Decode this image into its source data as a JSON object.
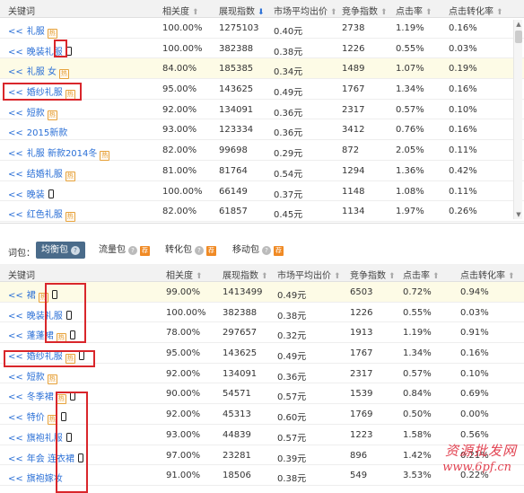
{
  "columns": {
    "keyword": "关键词",
    "relevance": "相关度",
    "impressions": "展现指数",
    "avg_bid": "市场平均出价",
    "competition": "竞争指数",
    "ctr": "点击率",
    "cvr": "点击转化率"
  },
  "arrow_up": "⬆",
  "arrow_down": "⬇",
  "prefix": "<<",
  "badge_text": "热",
  "top_table": {
    "rows": [
      {
        "keyword": "礼服",
        "badge": true,
        "phone": false,
        "relevance": "100.00%",
        "impressions": "1275103",
        "avg_bid": "0.40元",
        "competition": "2738",
        "ctr": "1.19%",
        "cvr": "0.16%"
      },
      {
        "keyword": "晚装礼服",
        "badge": false,
        "phone": true,
        "relevance": "100.00%",
        "impressions": "382388",
        "avg_bid": "0.38元",
        "competition": "1226",
        "ctr": "0.55%",
        "cvr": "0.03%"
      },
      {
        "keyword": "礼服 女",
        "badge": true,
        "phone": false,
        "relevance": "84.00%",
        "impressions": "185385",
        "avg_bid": "0.34元",
        "competition": "1489",
        "ctr": "1.07%",
        "cvr": "0.19%",
        "highlight": true
      },
      {
        "keyword": "婚纱礼服",
        "badge": true,
        "phone": false,
        "relevance": "95.00%",
        "impressions": "143625",
        "avg_bid": "0.49元",
        "competition": "1767",
        "ctr": "1.34%",
        "cvr": "0.16%"
      },
      {
        "keyword": "短款",
        "badge": true,
        "phone": false,
        "relevance": "92.00%",
        "impressions": "134091",
        "avg_bid": "0.36元",
        "competition": "2317",
        "ctr": "0.57%",
        "cvr": "0.10%"
      },
      {
        "keyword": "2015新款",
        "badge": false,
        "phone": false,
        "relevance": "93.00%",
        "impressions": "123334",
        "avg_bid": "0.36元",
        "competition": "3412",
        "ctr": "0.76%",
        "cvr": "0.16%"
      },
      {
        "keyword": "礼服 新款2014冬",
        "badge": true,
        "phone": false,
        "relevance": "82.00%",
        "impressions": "99698",
        "avg_bid": "0.29元",
        "competition": "872",
        "ctr": "2.05%",
        "cvr": "0.11%"
      },
      {
        "keyword": "结婚礼服",
        "badge": true,
        "phone": false,
        "relevance": "81.00%",
        "impressions": "81764",
        "avg_bid": "0.54元",
        "competition": "1294",
        "ctr": "1.36%",
        "cvr": "0.42%"
      },
      {
        "keyword": "晚装",
        "badge": false,
        "phone": true,
        "relevance": "100.00%",
        "impressions": "66149",
        "avg_bid": "0.37元",
        "competition": "1148",
        "ctr": "1.08%",
        "cvr": "0.11%"
      },
      {
        "keyword": "红色礼服",
        "badge": true,
        "phone": false,
        "relevance": "82.00%",
        "impressions": "61857",
        "avg_bid": "0.45元",
        "competition": "1134",
        "ctr": "1.97%",
        "cvr": "0.26%"
      }
    ]
  },
  "package_bar": {
    "label": "词包：",
    "tabs": [
      {
        "label": "均衡包",
        "active": true,
        "hot": false
      },
      {
        "label": "流量包",
        "active": false,
        "hot": true
      },
      {
        "label": "转化包",
        "active": false,
        "hot": true
      },
      {
        "label": "移动包",
        "active": false,
        "hot": true
      }
    ],
    "help": "?",
    "hot_text": "荐"
  },
  "bottom_table": {
    "rows": [
      {
        "keyword": "裙",
        "badge": true,
        "phone": true,
        "relevance": "99.00%",
        "impressions": "1413499",
        "avg_bid": "0.49元",
        "competition": "6503",
        "ctr": "0.72%",
        "cvr": "0.94%",
        "highlight": true
      },
      {
        "keyword": "晚装礼服",
        "badge": false,
        "phone": true,
        "relevance": "100.00%",
        "impressions": "382388",
        "avg_bid": "0.38元",
        "competition": "1226",
        "ctr": "0.55%",
        "cvr": "0.03%"
      },
      {
        "keyword": "蓬蓬裙",
        "badge": true,
        "phone": true,
        "relevance": "78.00%",
        "impressions": "297657",
        "avg_bid": "0.32元",
        "competition": "1913",
        "ctr": "1.19%",
        "cvr": "0.91%"
      },
      {
        "keyword": "婚纱礼服",
        "badge": true,
        "phone": true,
        "relevance": "95.00%",
        "impressions": "143625",
        "avg_bid": "0.49元",
        "competition": "1767",
        "ctr": "1.34%",
        "cvr": "0.16%"
      },
      {
        "keyword": "短款",
        "badge": true,
        "phone": false,
        "relevance": "92.00%",
        "impressions": "134091",
        "avg_bid": "0.36元",
        "competition": "2317",
        "ctr": "0.57%",
        "cvr": "0.10%"
      },
      {
        "keyword": "冬季裙",
        "badge": true,
        "phone": true,
        "relevance": "90.00%",
        "impressions": "54571",
        "avg_bid": "0.57元",
        "competition": "1539",
        "ctr": "0.84%",
        "cvr": "0.69%"
      },
      {
        "keyword": "特价",
        "badge": true,
        "phone": true,
        "relevance": "92.00%",
        "impressions": "45313",
        "avg_bid": "0.60元",
        "competition": "1769",
        "ctr": "0.50%",
        "cvr": "0.00%"
      },
      {
        "keyword": "旗袍礼服",
        "badge": false,
        "phone": true,
        "relevance": "93.00%",
        "impressions": "44839",
        "avg_bid": "0.57元",
        "competition": "1223",
        "ctr": "1.58%",
        "cvr": "0.56%"
      },
      {
        "keyword": "年会 连衣裙",
        "badge": false,
        "phone": true,
        "relevance": "97.00%",
        "impressions": "23281",
        "avg_bid": "0.39元",
        "competition": "896",
        "ctr": "1.42%",
        "cvr": "0.21%"
      },
      {
        "keyword": "旗袍嫁妆",
        "badge": false,
        "phone": false,
        "relevance": "91.00%",
        "impressions": "18506",
        "avg_bid": "0.38元",
        "competition": "549",
        "ctr": "3.53%",
        "cvr": "0.22%"
      }
    ]
  },
  "watermark": {
    "text": "资源批发网",
    "url": "www.6pf.cn"
  },
  "colors": {
    "link": "#2a6fd6",
    "highlight_box": "#d9262b",
    "active_tab": "#4a6b8a",
    "hot": "#f08a24"
  }
}
